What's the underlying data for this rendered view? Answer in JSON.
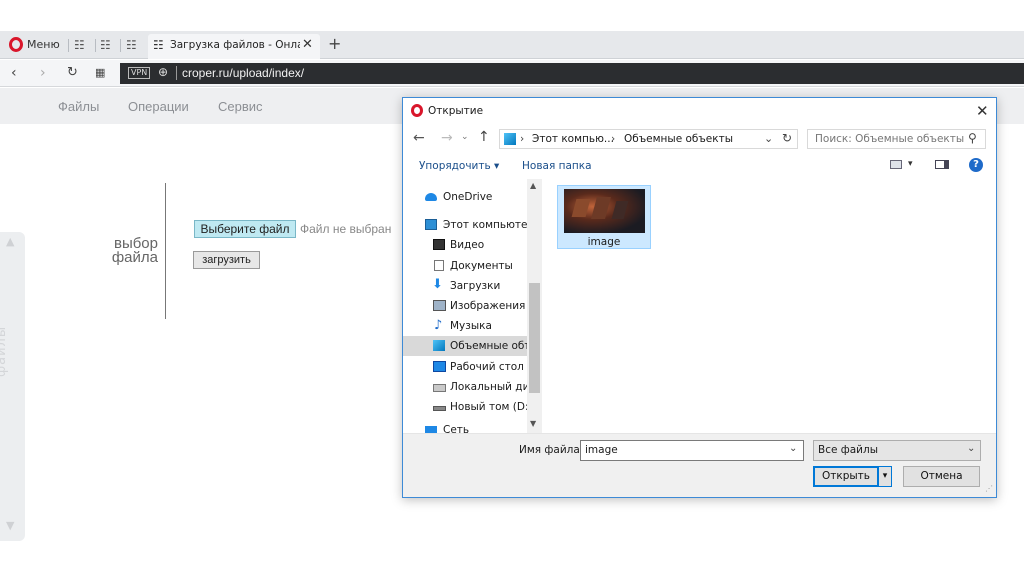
{
  "browser": {
    "menu_label": "Меню",
    "active_tab_title": "Загрузка файлов - Онлай",
    "url": "croper.ru/upload/index/",
    "vpn_label": "VPN",
    "brand_color": "#d9162b"
  },
  "site": {
    "menu": [
      "Файлы",
      "Операции",
      "Сервис"
    ],
    "side_label": "файлы"
  },
  "upload": {
    "label_line1": "выбор",
    "label_line2": "файла",
    "choose_button": "Выберите файл",
    "no_file_text": "Файл не выбран",
    "upload_button": "загрузить"
  },
  "dialog": {
    "title": "Открытие",
    "breadcrumb": [
      "Этот компью...",
      "Объемные объекты"
    ],
    "search_placeholder": "Поиск: Объемные объекты",
    "organize_label": "Упорядочить ▾",
    "new_folder_label": "Новая папка",
    "nav_items": [
      {
        "label": "OneDrive",
        "icon": "cloud-icon"
      },
      {
        "label": "Этот компьютер",
        "icon": "computer-icon"
      },
      {
        "label": "Видео",
        "icon": "video-icon"
      },
      {
        "label": "Документы",
        "icon": "documents-icon"
      },
      {
        "label": "Загрузки",
        "icon": "download-icon"
      },
      {
        "label": "Изображения",
        "icon": "images-icon"
      },
      {
        "label": "Музыка",
        "icon": "music-icon"
      },
      {
        "label": "Объемные объекты",
        "icon": "3d-objects-icon"
      },
      {
        "label": "Рабочий стол",
        "icon": "desktop-icon"
      },
      {
        "label": "Локальный диск",
        "icon": "drive-icon"
      },
      {
        "label": "Новый том (D:)",
        "icon": "drive-icon"
      },
      {
        "label": "Сеть",
        "icon": "network-icon"
      }
    ],
    "file_item": {
      "name": "image"
    },
    "filename_label": "Имя файла:",
    "filename_value": "image",
    "filetype_value": "Все файлы",
    "open_button": "Открыть",
    "cancel_button": "Отмена"
  }
}
